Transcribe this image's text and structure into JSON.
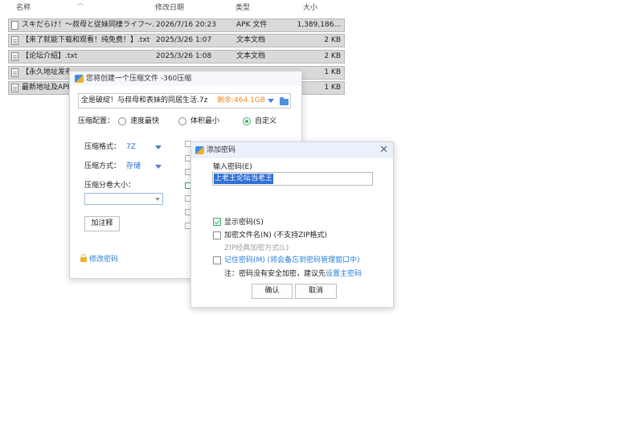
{
  "explorer": {
    "columns": {
      "name": "名称",
      "modified": "修改日期",
      "type": "类型",
      "size": "大小"
    },
    "files": [
      {
        "name": "スキだらけ！～叔母と従妹同棲ライフ～...",
        "modified": "2026/7/16 20:23",
        "type": "APK 文件",
        "size": "1,389,186...",
        "icon": "file-icon"
      },
      {
        "name": "【来了就能下载和观看！纯免费！】.txt",
        "modified": "2025/3/26 1:07",
        "type": "文本文档",
        "size": "2 KB",
        "icon": "text-file-icon"
      },
      {
        "name": "【论坛介绍】.txt",
        "modified": "2025/3/26 1:08",
        "type": "文本文档",
        "size": "2 KB",
        "icon": "text-file-icon"
      },
      {
        "name": "【永久地址发布页】",
        "modified": "",
        "type": "",
        "size": "1 KB",
        "icon": "text-file-icon"
      },
      {
        "name": "最新地址及APP",
        "modified": "",
        "type": "",
        "size": "1 KB",
        "icon": "text-file-icon"
      }
    ]
  },
  "compress": {
    "title": "您将创建一个压缩文件 -360压缩",
    "path": "全是破绽！与叔母和表妹的同居生活.7z",
    "free_space": "剩余:464.1GB",
    "config_label": "压缩配置：",
    "options": [
      "速度最快",
      "体积最小",
      "自定义"
    ],
    "selected_option": "自定义",
    "format_label": "压缩格式：",
    "format_value": "7Z",
    "method_label": "压缩方式：",
    "method_value": "存储",
    "split_label": "压缩分卷大小：",
    "split_value": "",
    "comment_button": "加注释",
    "change_password": "修改密码"
  },
  "password": {
    "title": "添加密码",
    "input_label": "输入密码(E)",
    "input_value": "上老王论坛当老王",
    "show_password": "显示密码(S)",
    "encrypt_names": "加密文件名(N)  (不支持ZIP格式)",
    "zip_classic": "ZIP经典加密方式(L)",
    "remember_password": "记住密码(M)  (将会备忘到密码管理窗口中)",
    "note_prefix": "注：密码没有安全加密，建议先",
    "note_link": "设置主密码",
    "ok_button": "确认",
    "cancel_button": "取消",
    "checked": {
      "show_password": true,
      "encrypt_names": false,
      "zip_classic": false,
      "remember_password": false
    }
  },
  "colors": {
    "accent_blue": "#2f6fd6",
    "check_green": "#3cae6a",
    "free_space_orange": "#f08a24"
  }
}
